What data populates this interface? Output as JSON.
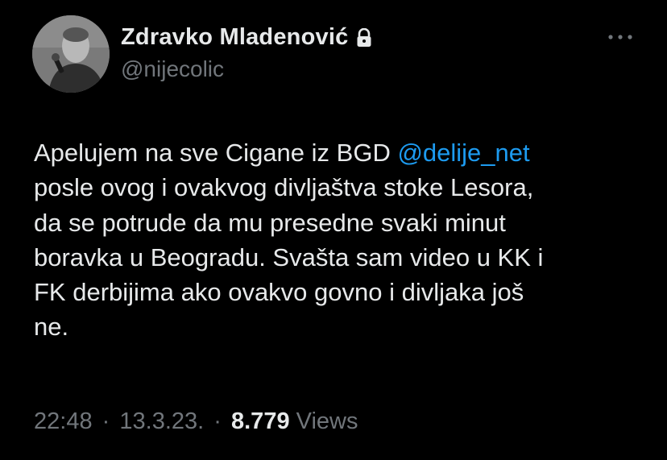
{
  "author": {
    "display_name": "Zdravko Mladenović",
    "handle": "@nijecolic",
    "protected_icon": "lock-icon",
    "avatar_icon": "profile-photo"
  },
  "menu": {
    "more_icon": "more-horizontal-icon"
  },
  "tweet": {
    "text_before_mention": "Apelujem na sve Cigane iz BGD ",
    "mention": "@delije_net",
    "text_after_mention": "\nposle ovog i ovakvog divljaštva stoke Lesora,\nda se potrude da mu presedne svaki minut\nboravka u Beogradu. Svašta sam video u KK i\nFK derbijima ako ovakvo govno i divljaka još\nne."
  },
  "meta": {
    "time": "22:48",
    "date": "13.3.23.",
    "separator": "·",
    "views_count": "8.779",
    "views_label": "Views"
  },
  "colors": {
    "background": "#000000",
    "primary_text": "#e7e9ea",
    "secondary_text": "#71767b",
    "link": "#1d9bf0"
  }
}
